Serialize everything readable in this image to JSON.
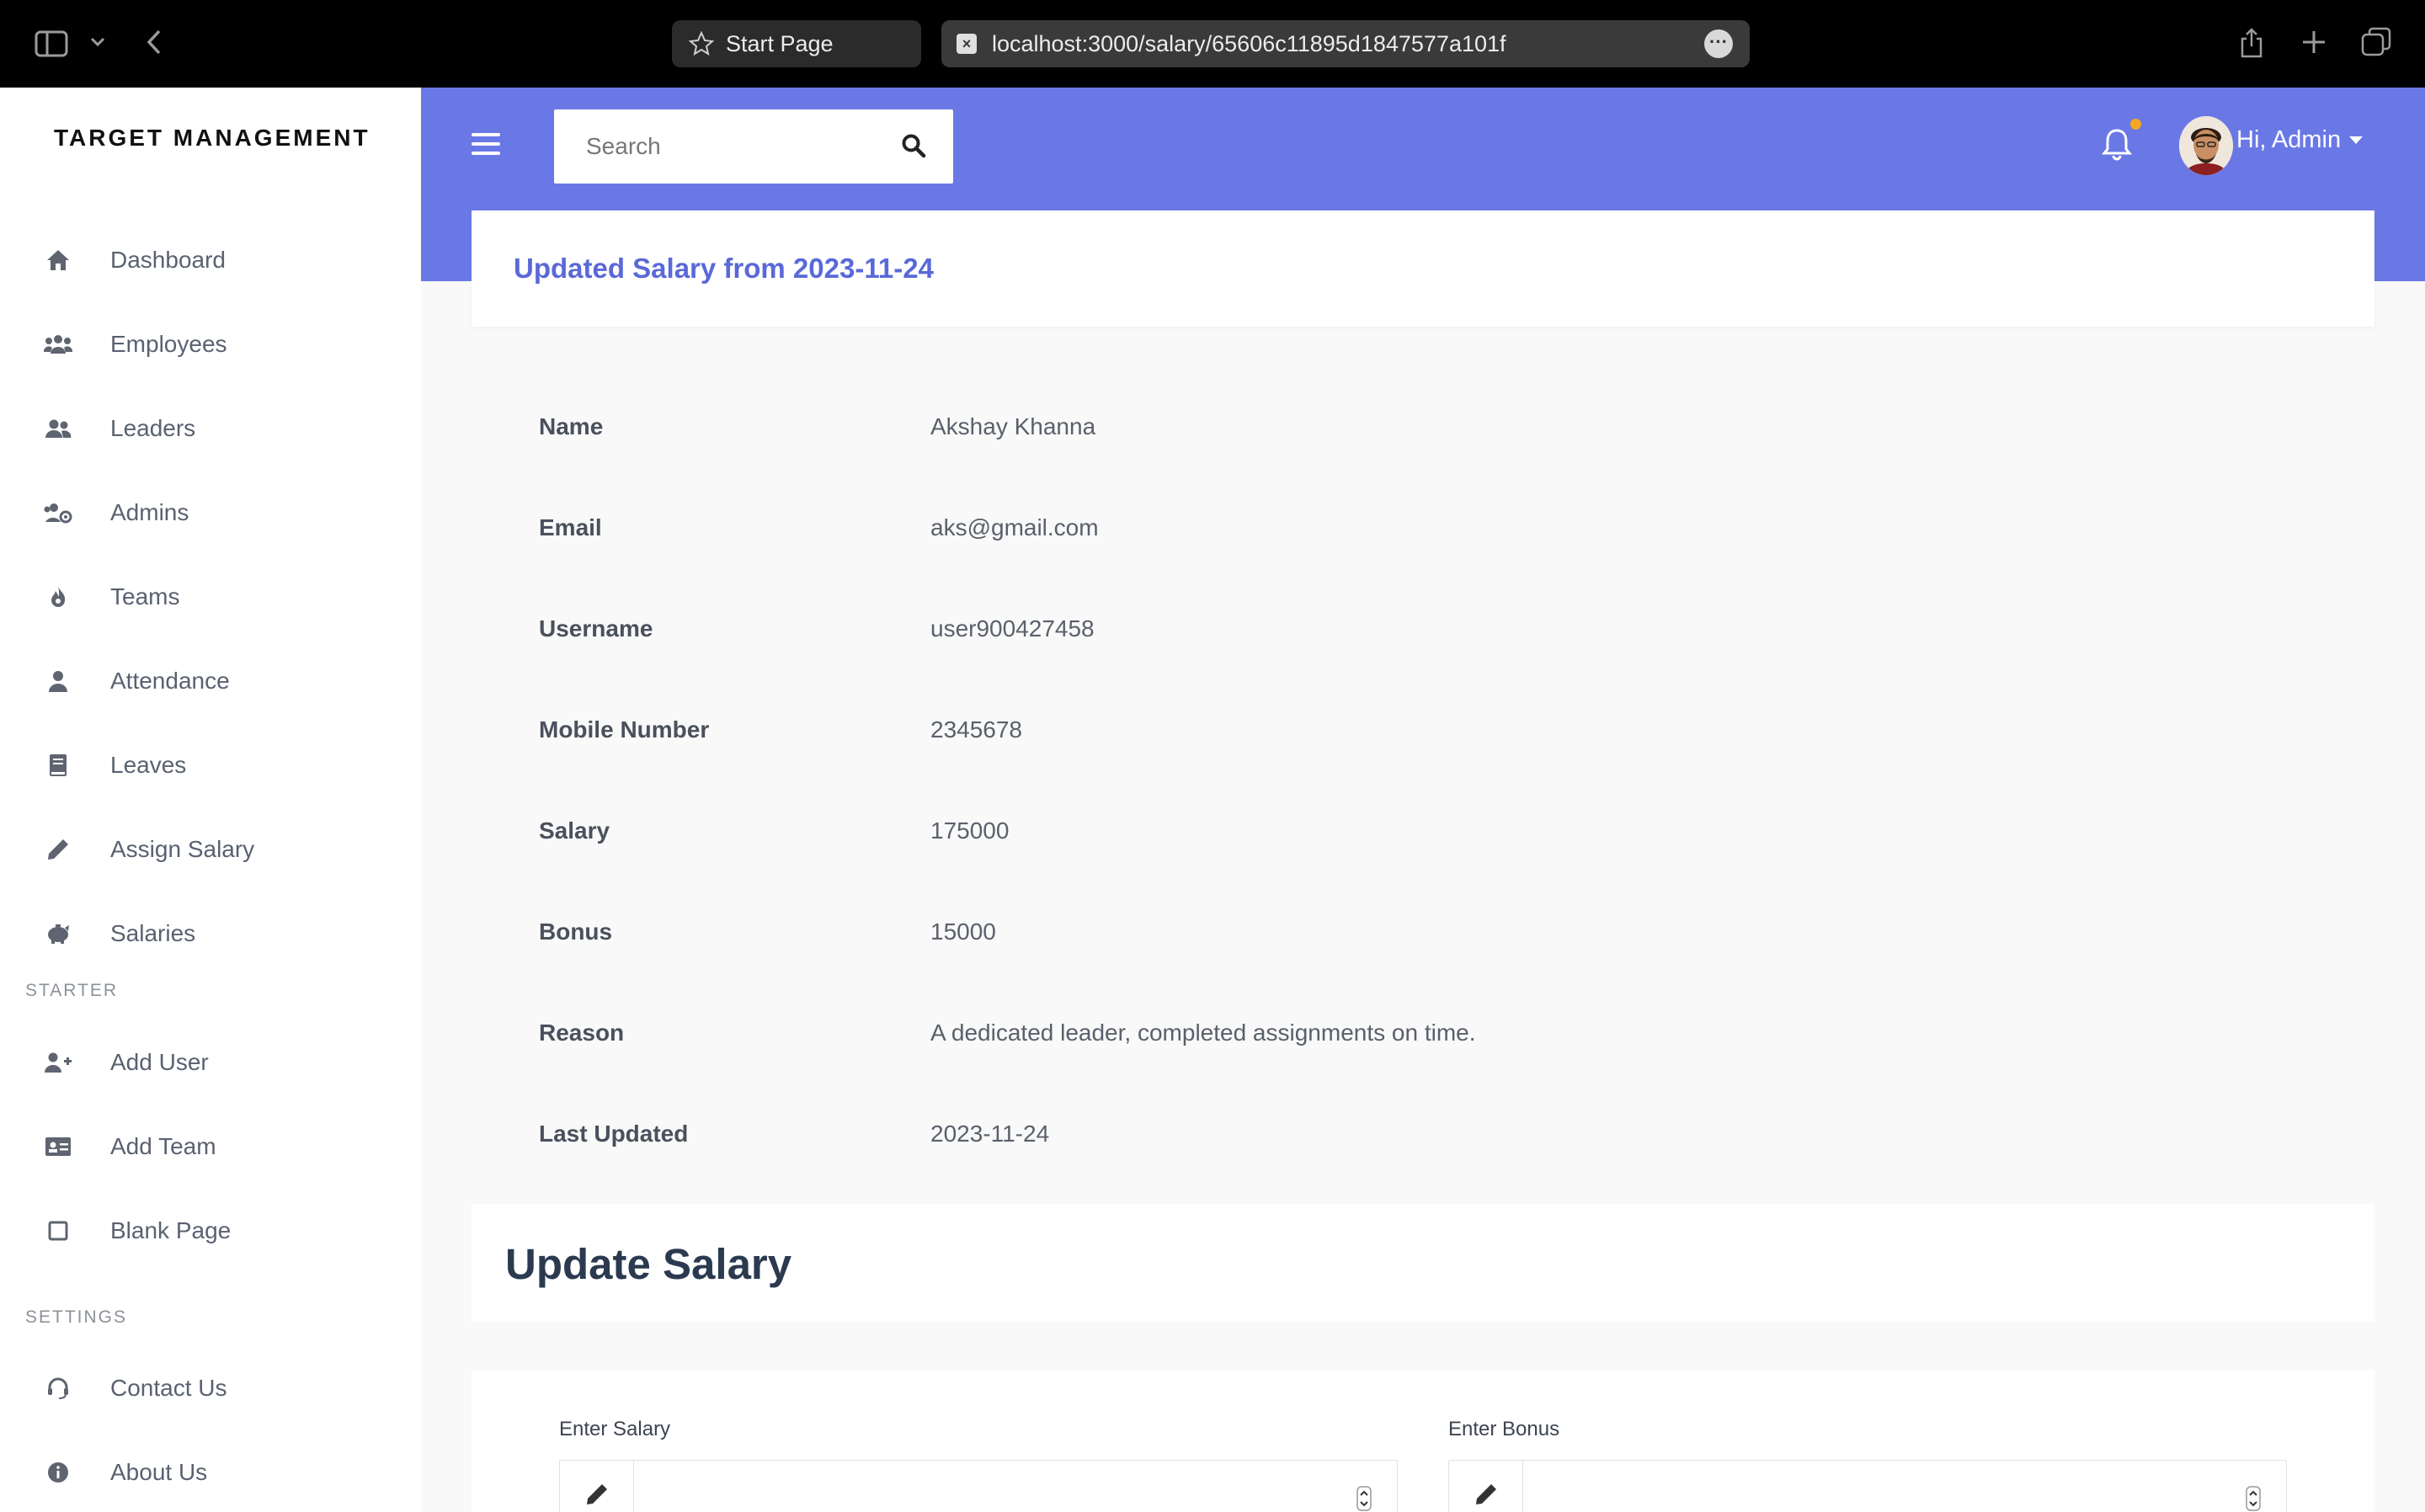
{
  "browser": {
    "start_tab_label": "Start Page",
    "url": "localhost:3000/salary/65606c11895d1847577a101f"
  },
  "sidebar": {
    "brand": "TARGET MANAGEMENT",
    "items": [
      {
        "label": "Dashboard",
        "icon": "home-icon"
      },
      {
        "label": "Employees",
        "icon": "users-icon"
      },
      {
        "label": "Leaders",
        "icon": "user-friends-icon"
      },
      {
        "label": "Admins",
        "icon": "users-cog-icon"
      },
      {
        "label": "Teams",
        "icon": "fire-icon"
      },
      {
        "label": "Attendance",
        "icon": "user-icon"
      },
      {
        "label": "Leaves",
        "icon": "book-icon"
      },
      {
        "label": "Assign Salary",
        "icon": "pencil-icon"
      },
      {
        "label": "Salaries",
        "icon": "piggy-bank-icon"
      }
    ],
    "section_starter": "STARTER",
    "starter_items": [
      {
        "label": "Add User",
        "icon": "user-plus-icon"
      },
      {
        "label": "Add Team",
        "icon": "id-card-icon"
      },
      {
        "label": "Blank Page",
        "icon": "square-icon"
      }
    ],
    "section_settings": "SETTINGS",
    "settings_items": [
      {
        "label": "Contact Us",
        "icon": "headset-icon"
      },
      {
        "label": "About Us",
        "icon": "info-circle-icon"
      }
    ]
  },
  "header": {
    "search_placeholder": "Search",
    "user_greeting": "Hi, Admin"
  },
  "salary_card": {
    "title": "Updated Salary from 2023-11-24"
  },
  "details": [
    {
      "label": "Name",
      "value": "Akshay Khanna"
    },
    {
      "label": "Email",
      "value": "aks@gmail.com"
    },
    {
      "label": "Username",
      "value": "user900427458"
    },
    {
      "label": "Mobile Number",
      "value": "2345678"
    },
    {
      "label": "Salary",
      "value": "175000"
    },
    {
      "label": "Bonus",
      "value": "15000"
    },
    {
      "label": "Reason",
      "value": "A dedicated leader, completed assignments on time."
    },
    {
      "label": "Last Updated",
      "value": "2023-11-24"
    }
  ],
  "update": {
    "title": "Update Salary",
    "salary_label": "Enter Salary",
    "bonus_label": "Enter Bonus"
  },
  "colors": {
    "header_bg": "#6a78e6",
    "title_accent": "#5a69d8",
    "notification_dot": "#f5a623"
  }
}
